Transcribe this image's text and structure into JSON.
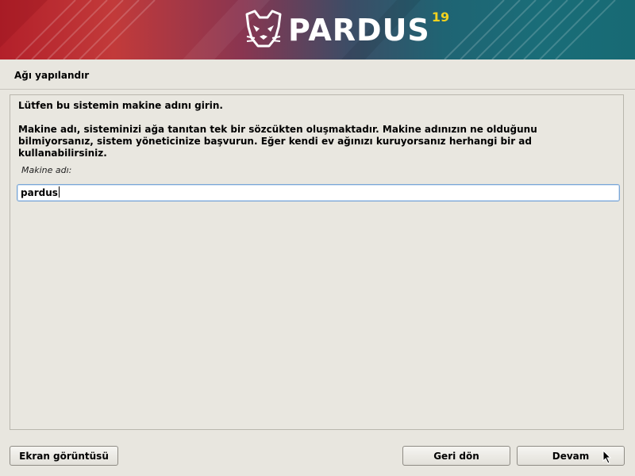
{
  "banner": {
    "brand": "PARDUS",
    "version": "19",
    "colors": {
      "left": "#b3202a",
      "right": "#176a74",
      "version": "#f2d21f"
    }
  },
  "page": {
    "title": "Ağı yapılandır"
  },
  "panel": {
    "intro": "Lütfen bu sistemin makine adını girin.",
    "description": "Makine adı, sisteminizi ağa tanıtan tek bir sözcükten oluşmaktadır. Makine adınızın ne olduğunu bilmiyorsanız, sistem yöneticinize başvurun. Eğer kendi ev ağınızı kuruyorsanız herhangi bir ad kullanabilirsiniz.",
    "field_label": "Makine adı:",
    "hostname_value": "pardus"
  },
  "buttons": {
    "screenshot": "Ekran görüntüsü",
    "back": "Geri dön",
    "continue": "Devam"
  },
  "icons": {
    "logo": "panther-head-icon",
    "cursor": "mouse-pointer-icon"
  }
}
